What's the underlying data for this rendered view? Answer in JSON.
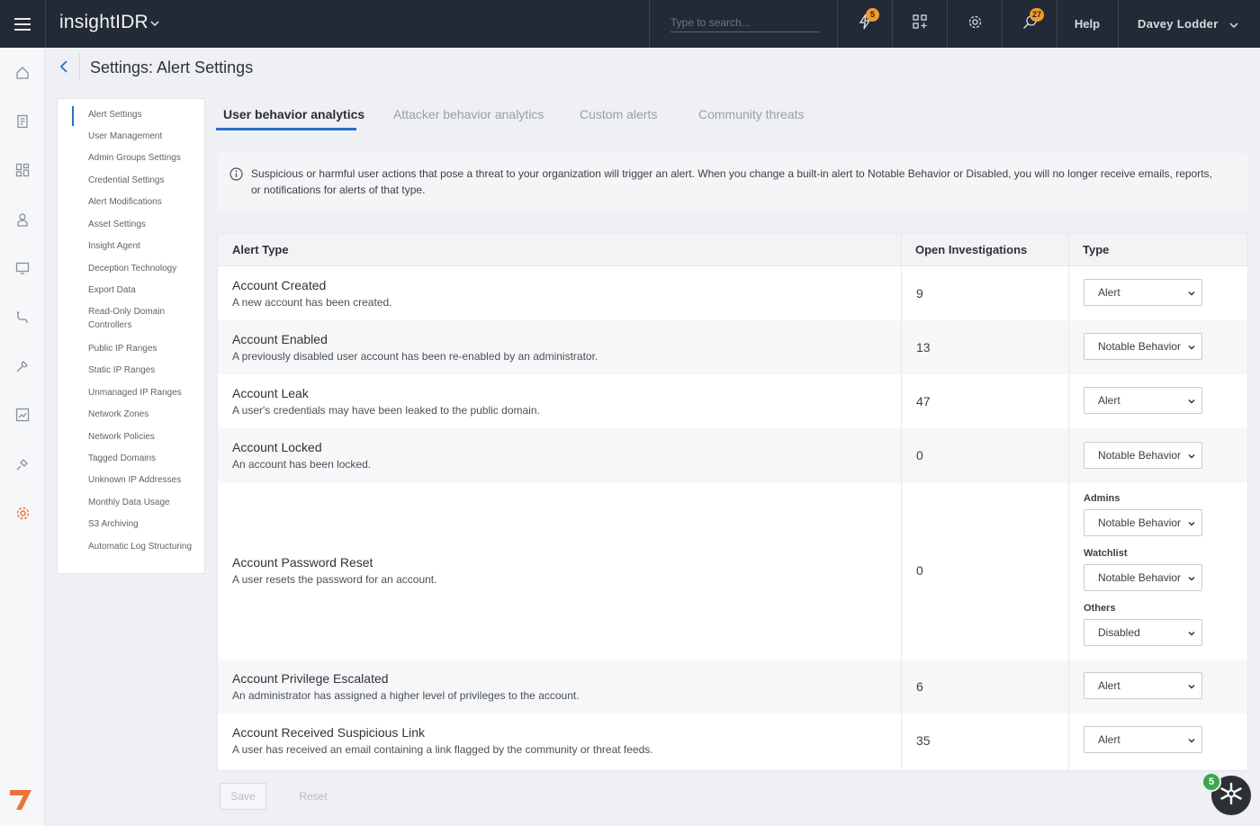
{
  "app": {
    "name": "insightIDR"
  },
  "search": {
    "placeholder": "Type to search..."
  },
  "topbar": {
    "notifications_badge": "5",
    "messages_badge": "27",
    "help_label": "Help",
    "user_name": "Davey Lodder"
  },
  "page": {
    "title": "Settings: Alert Settings"
  },
  "settings_nav": {
    "items": [
      "Alert Settings",
      "User Management",
      "Admin Groups Settings",
      "Credential Settings",
      "Alert Modifications",
      "Asset Settings",
      "Insight Agent",
      "Deception Technology",
      "Export Data",
      "Read-Only Domain Controllers",
      "Public IP Ranges",
      "Static IP Ranges",
      "Unmanaged IP Ranges",
      "Network Zones",
      "Network Policies",
      "Tagged Domains",
      "Unknown IP Addresses",
      "Monthly Data Usage",
      "S3 Archiving",
      "Automatic Log Structuring"
    ]
  },
  "tabs": [
    "User behavior analytics",
    "Attacker behavior analytics",
    "Custom alerts",
    "Community threats"
  ],
  "info": {
    "text": "Suspicious or harmful user actions that pose a threat to your organization will trigger an alert. When you change a built-in alert to Notable Behavior or Disabled, you will no longer receive emails, reports, or notifications for alerts of that type."
  },
  "table": {
    "headers": [
      "Alert Type",
      "Open Investigations",
      "Type"
    ],
    "rows": [
      {
        "name": "Account Created",
        "desc": "A new account has been created.",
        "count": "9",
        "type": "Alert"
      },
      {
        "name": "Account Enabled",
        "desc": "A previously disabled user account has been re-enabled by an administrator.",
        "count": "13",
        "type": "Notable Behavior"
      },
      {
        "name": "Account Leak",
        "desc": "A user's credentials may have been leaked to the public domain.",
        "count": "47",
        "type": "Alert"
      },
      {
        "name": "Account Locked",
        "desc": "An account has been locked.",
        "count": "0",
        "type": "Notable Behavior"
      },
      {
        "name": "Account Password Reset",
        "desc": "A user resets the password for an account.",
        "count": "0",
        "groups": [
          {
            "label": "Admins",
            "type": "Notable Behavior"
          },
          {
            "label": "Watchlist",
            "type": "Notable Behavior"
          },
          {
            "label": "Others",
            "type": "Disabled"
          }
        ]
      },
      {
        "name": "Account Privilege Escalated",
        "desc": "An administrator has assigned a higher level of privileges to the account.",
        "count": "6",
        "type": "Alert"
      },
      {
        "name": "Account Received Suspicious Link",
        "desc": "A user has received an email containing a link flagged by the community or threat feeds.",
        "count": "35",
        "type": "Alert"
      }
    ]
  },
  "footer": {
    "save_label": "Save",
    "reset_label": "Reset"
  },
  "helper": {
    "badge": "5"
  },
  "colors": {
    "accent": "#2a6fc9",
    "topbar": "#222a36",
    "badge": "#f29b2c",
    "active_rail_icon": "#e8743b"
  }
}
